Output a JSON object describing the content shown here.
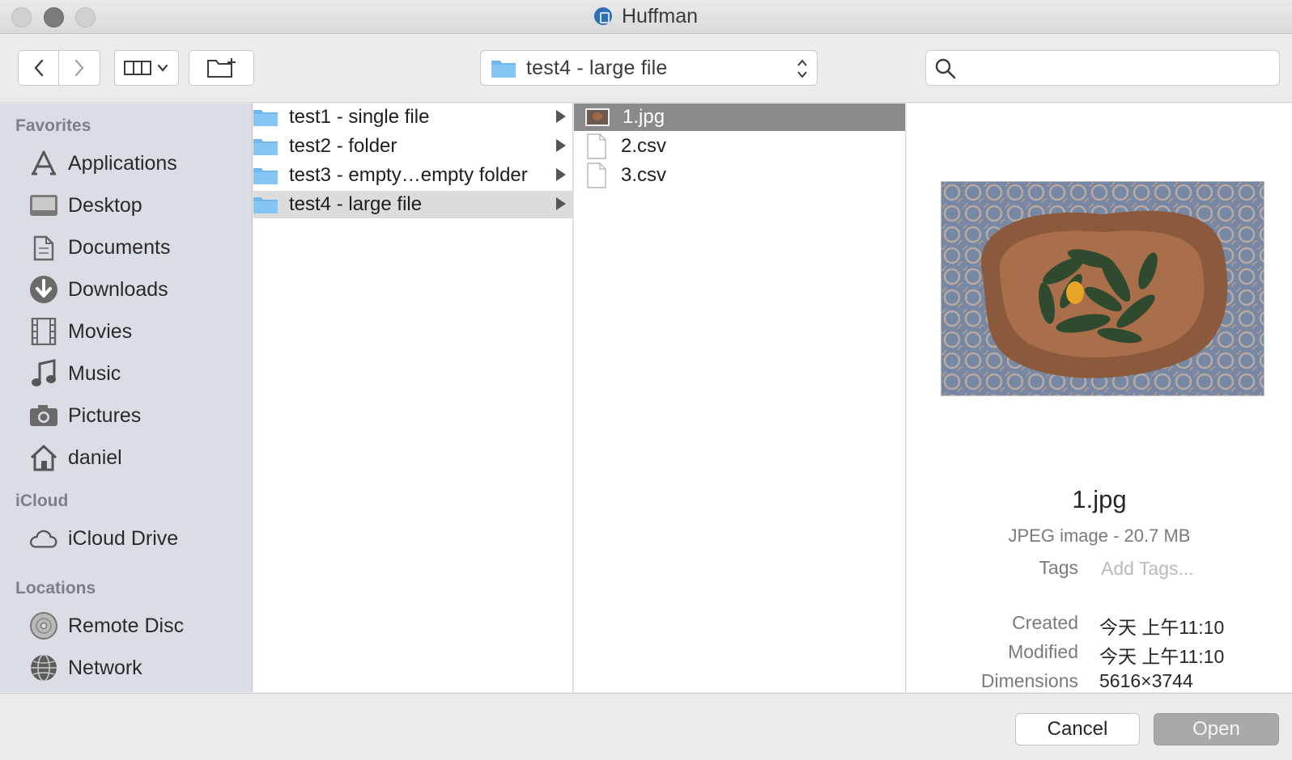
{
  "window": {
    "title": "Huffman"
  },
  "toolbar": {
    "back_icon": "chevron-left-icon",
    "forward_icon": "chevron-right-icon",
    "view_icon": "column-view-icon",
    "new_folder_icon": "new-folder-icon",
    "path_label": "test4 - large file",
    "search_placeholder": ""
  },
  "sidebar": {
    "sections": [
      {
        "header": "Favorites",
        "items": [
          {
            "label": "Applications",
            "icon": "applications-icon"
          },
          {
            "label": "Desktop",
            "icon": "desktop-icon"
          },
          {
            "label": "Documents",
            "icon": "documents-icon"
          },
          {
            "label": "Downloads",
            "icon": "downloads-icon"
          },
          {
            "label": "Movies",
            "icon": "movies-icon"
          },
          {
            "label": "Music",
            "icon": "music-icon"
          },
          {
            "label": "Pictures",
            "icon": "pictures-icon"
          },
          {
            "label": "daniel",
            "icon": "home-icon"
          }
        ]
      },
      {
        "header": "iCloud",
        "items": [
          {
            "label": "iCloud Drive",
            "icon": "cloud-icon"
          }
        ]
      },
      {
        "header": "Locations",
        "items": [
          {
            "label": "Remote Disc",
            "icon": "disc-icon"
          },
          {
            "label": "Network",
            "icon": "network-icon"
          }
        ]
      }
    ]
  },
  "column1": {
    "items": [
      {
        "label": "test1 - single file",
        "selected": false
      },
      {
        "label": "test2 - folder",
        "selected": false
      },
      {
        "label": "test3 - empty…empty folder",
        "selected": false
      },
      {
        "label": "test4 - large file",
        "selected": true
      }
    ]
  },
  "column2": {
    "items": [
      {
        "label": "1.jpg",
        "kind": "image",
        "selected": true
      },
      {
        "label": "2.csv",
        "kind": "document",
        "selected": false
      },
      {
        "label": "3.csv",
        "kind": "document",
        "selected": false
      }
    ]
  },
  "preview": {
    "file_name": "1.jpg",
    "kind_size": "JPEG image - 20.7 MB",
    "tags_label": "Tags",
    "tags_placeholder": "Add Tags...",
    "created_label": "Created",
    "created_value": "今天 上午11:10",
    "modified_label": "Modified",
    "modified_value": "今天 上午11:10",
    "dimensions_label": "Dimensions",
    "dimensions_value": "5616×3744"
  },
  "buttons": {
    "cancel": "Cancel",
    "open": "Open"
  },
  "colors": {
    "sidebar_bg": "#dadde3",
    "selected_row_dark": "#8a8a8a",
    "selected_row_gray": "#dcdcdc",
    "folder_blue": "#6fb8ee",
    "open_button_disabled": "#a9a9a9"
  }
}
